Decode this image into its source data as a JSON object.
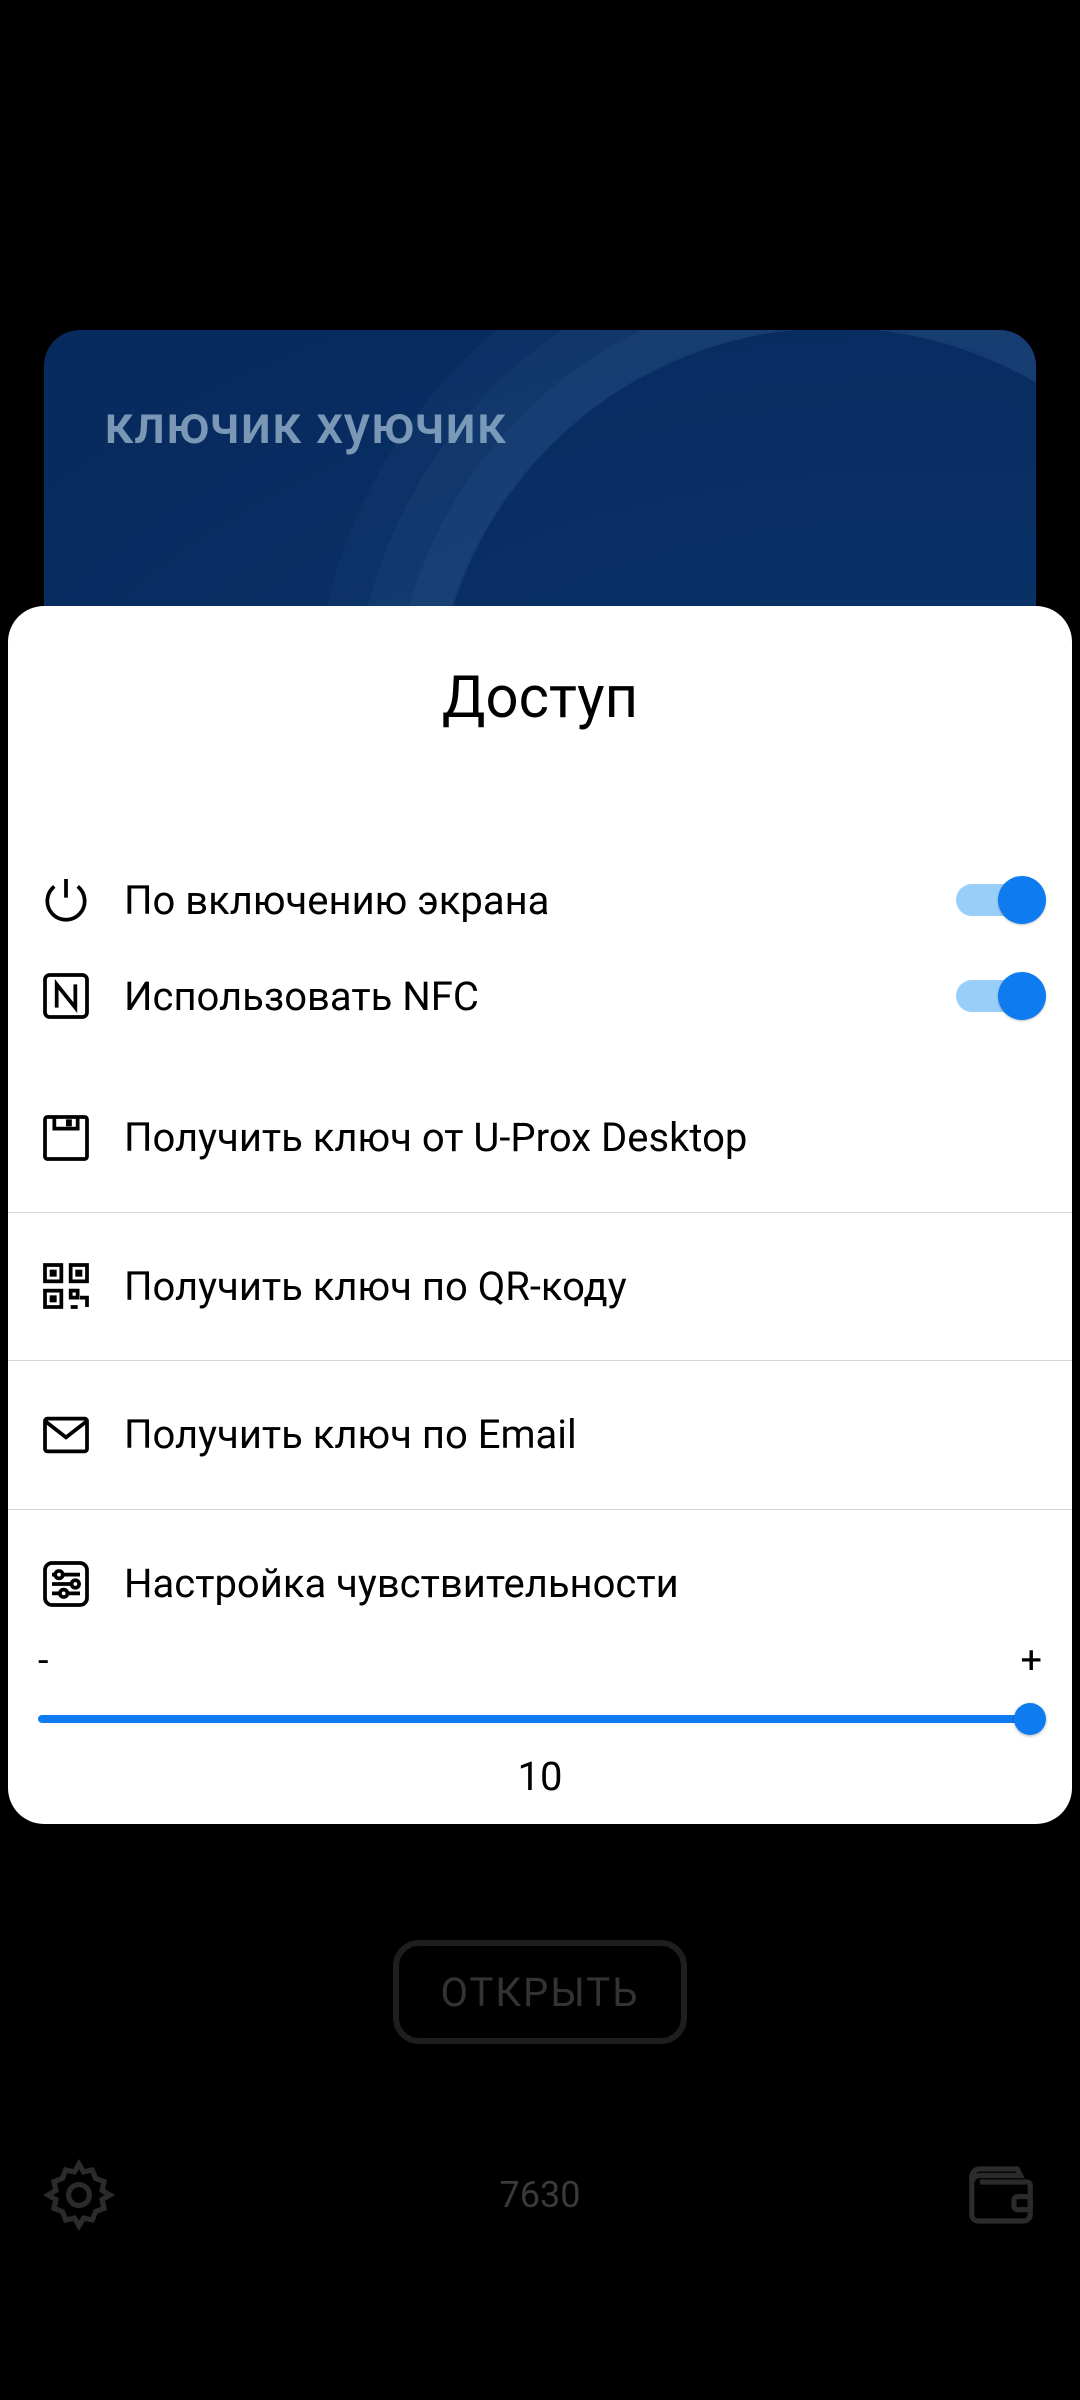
{
  "card": {
    "title": "ключик хуючик"
  },
  "sheet": {
    "title": "Доступ",
    "toggles": {
      "screen_on": {
        "label": "По включению экрана",
        "value": true
      },
      "nfc": {
        "label": "Использовать NFC",
        "value": true
      }
    },
    "options": {
      "desktop": "Получить ключ от U-Prox Desktop",
      "qr": "Получить ключ по QR-коду",
      "email": "Получить ключ по Email"
    },
    "sensitivity": {
      "label": "Настройка чувствительности",
      "minus": "-",
      "plus": "+",
      "value": "10"
    }
  },
  "open_button": "ОТКРЫТЬ",
  "bottom_id": "7630"
}
